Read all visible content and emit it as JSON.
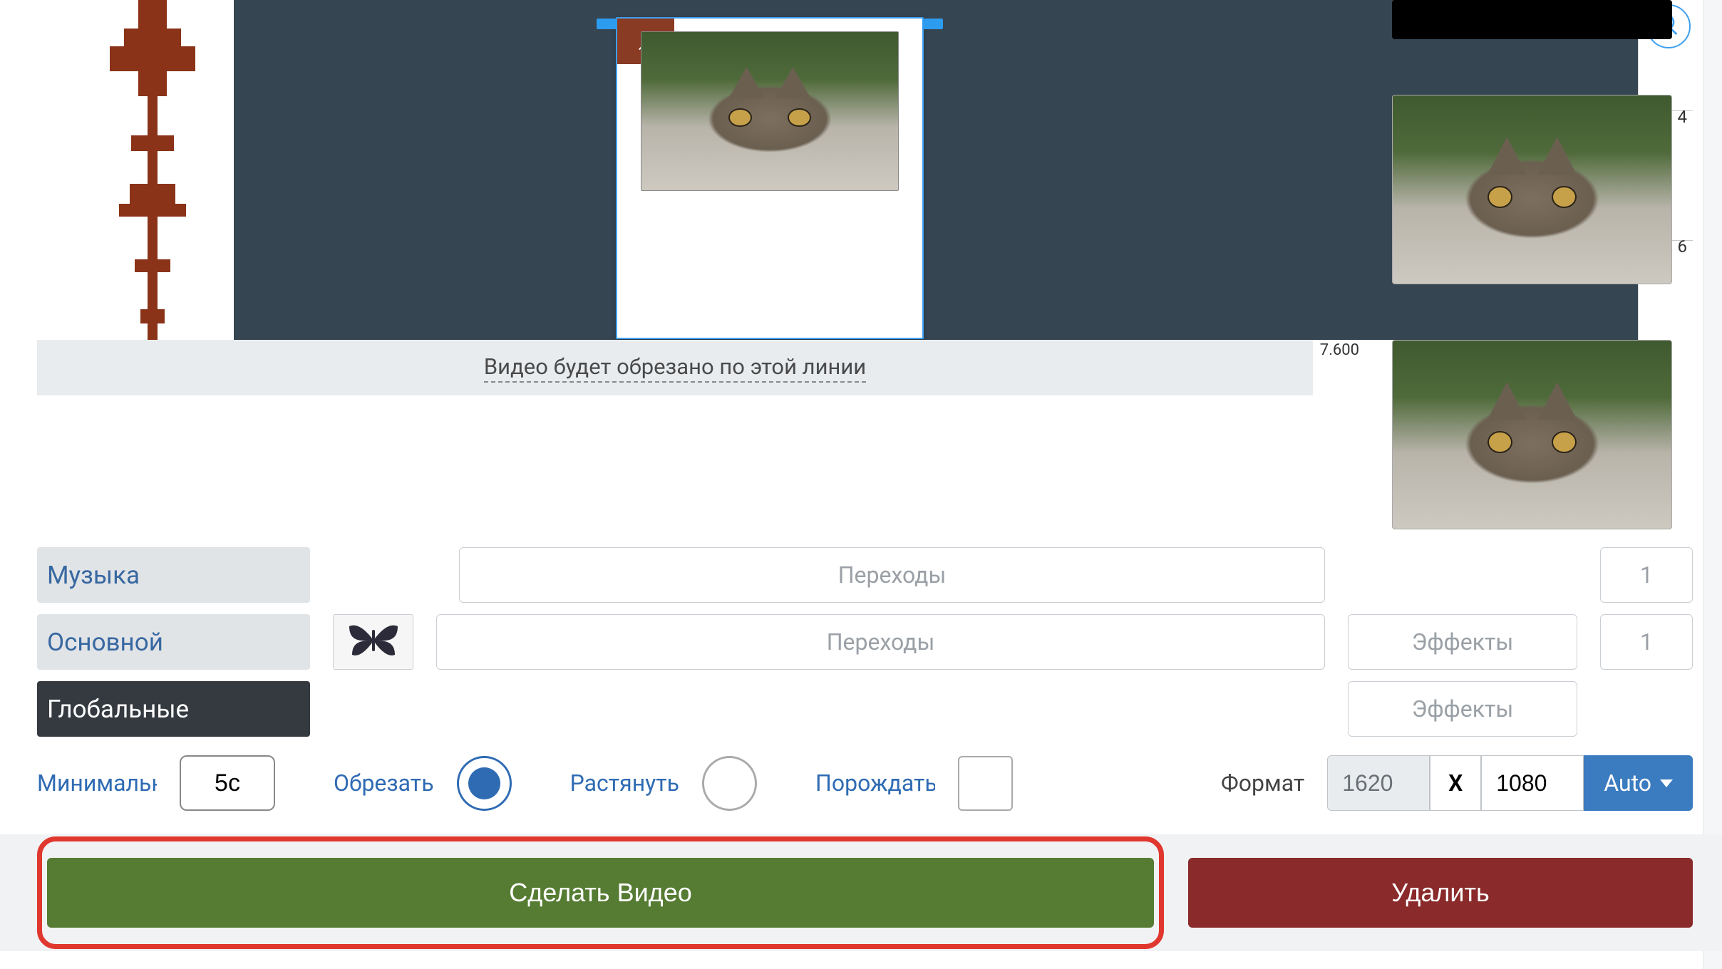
{
  "timeline": {
    "ruler": {
      "ticks": [
        "4",
        "6"
      ],
      "end_time": "7.600"
    },
    "crop_note": "Видео будет обрезано по этой линии"
  },
  "layers": {
    "music": {
      "label": "Музыка",
      "transitions": "Переходы",
      "count": "1"
    },
    "main": {
      "label": "Основной",
      "transitions": "Переходы",
      "effects": "Эффекты",
      "count": "1"
    },
    "global": {
      "label": "Глобальные",
      "effects": "Эффекты"
    }
  },
  "options": {
    "minimal_label": "Минимальн",
    "minimal_value": "5с",
    "crop_label": "Обрезать",
    "stretch_label": "Растянуть",
    "generate_label": "Порождать",
    "format_label": "Формат",
    "width": "1620",
    "x": "X",
    "height": "1080",
    "auto": "Auto"
  },
  "actions": {
    "make_video": "Сделать Видео",
    "delete": "Удалить"
  }
}
